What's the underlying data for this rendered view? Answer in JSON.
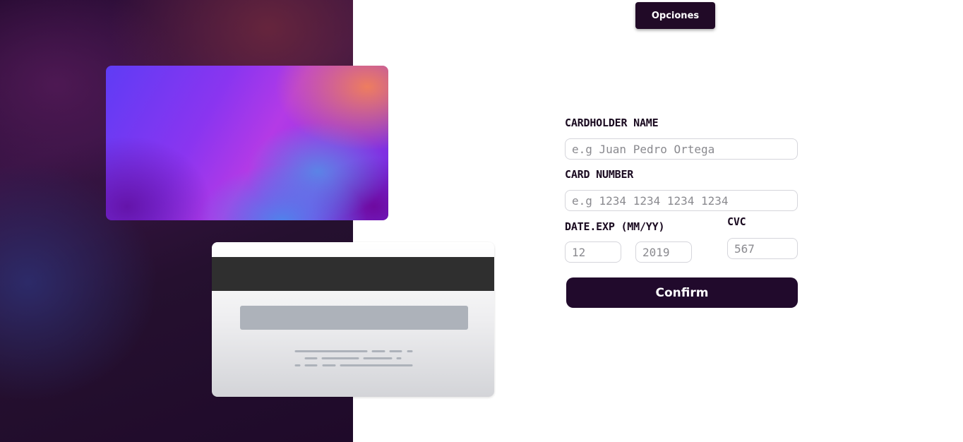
{
  "header": {
    "options_label": "Opciones"
  },
  "form": {
    "cardholder_label": "CARDHOLDER NAME",
    "cardholder_placeholder": "e.g Juan Pedro Ortega",
    "card_number_label": "CARD NUMBER",
    "card_number_placeholder": "e.g 1234 1234 1234 1234",
    "date_label": "DATE.EXP (MM/YY)",
    "month_placeholder": "12",
    "year_placeholder": "2019",
    "cvc_label": "CVC",
    "cvc_placeholder": "567",
    "confirm_label": "Confirm"
  },
  "colors": {
    "primary_dark": "#210a2c",
    "card_front_gradient": [
      "#5f3cf5",
      "#b43ae6",
      "#ee7d5f",
      "#5082eb"
    ],
    "magnetic_stripe": "#2f2f2f"
  }
}
